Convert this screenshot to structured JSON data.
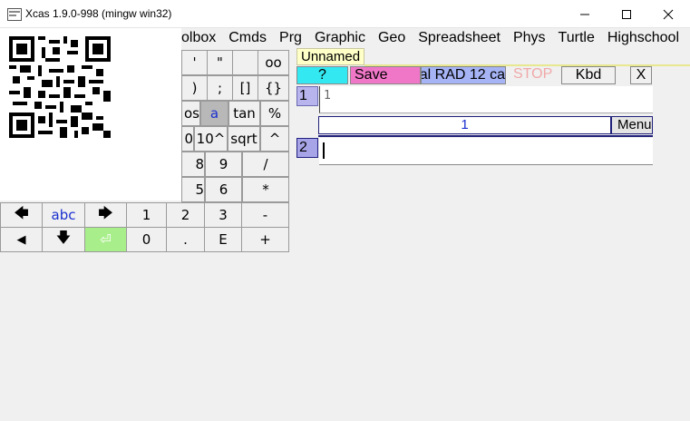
{
  "window": {
    "title": "Xcas 1.9.0-998 (mingw win32)",
    "minimize": "—",
    "maximize": "☐",
    "close": "✕"
  },
  "menu": [
    "olbox",
    "Cmds",
    "Prg",
    "Graphic",
    "Geo",
    "Spreadsheet",
    "Phys",
    "Turtle",
    "Highschool"
  ],
  "keypad": {
    "row1": [
      "'",
      "\"",
      "",
      "oo"
    ],
    "row2": [
      ")",
      ";",
      "[]",
      "{}"
    ],
    "row3": [
      "os",
      "a",
      "tan",
      "%"
    ],
    "row4": [
      "0",
      "10^",
      "sqrt",
      "^"
    ],
    "row5": [
      "8",
      "9",
      "/"
    ],
    "row6": [
      "5",
      "6",
      "*"
    ],
    "row7": [
      "🡄",
      "abc",
      "🡆",
      "1",
      "2",
      "3",
      "-"
    ],
    "row8": [
      "◀",
      "🡇",
      "⏎",
      "0",
      ".",
      "E",
      "+"
    ]
  },
  "session": {
    "tab": "Unnamed",
    "help": "?",
    "save": "Save",
    "config": "al RAD 12 ca",
    "stop": "STOP",
    "kbd": "Kbd",
    "close": "X",
    "line1_num": "1",
    "line1_input": "1",
    "line1_output": "1",
    "line1_menu": "Menu",
    "line2_num": "2",
    "line2_input": ""
  }
}
